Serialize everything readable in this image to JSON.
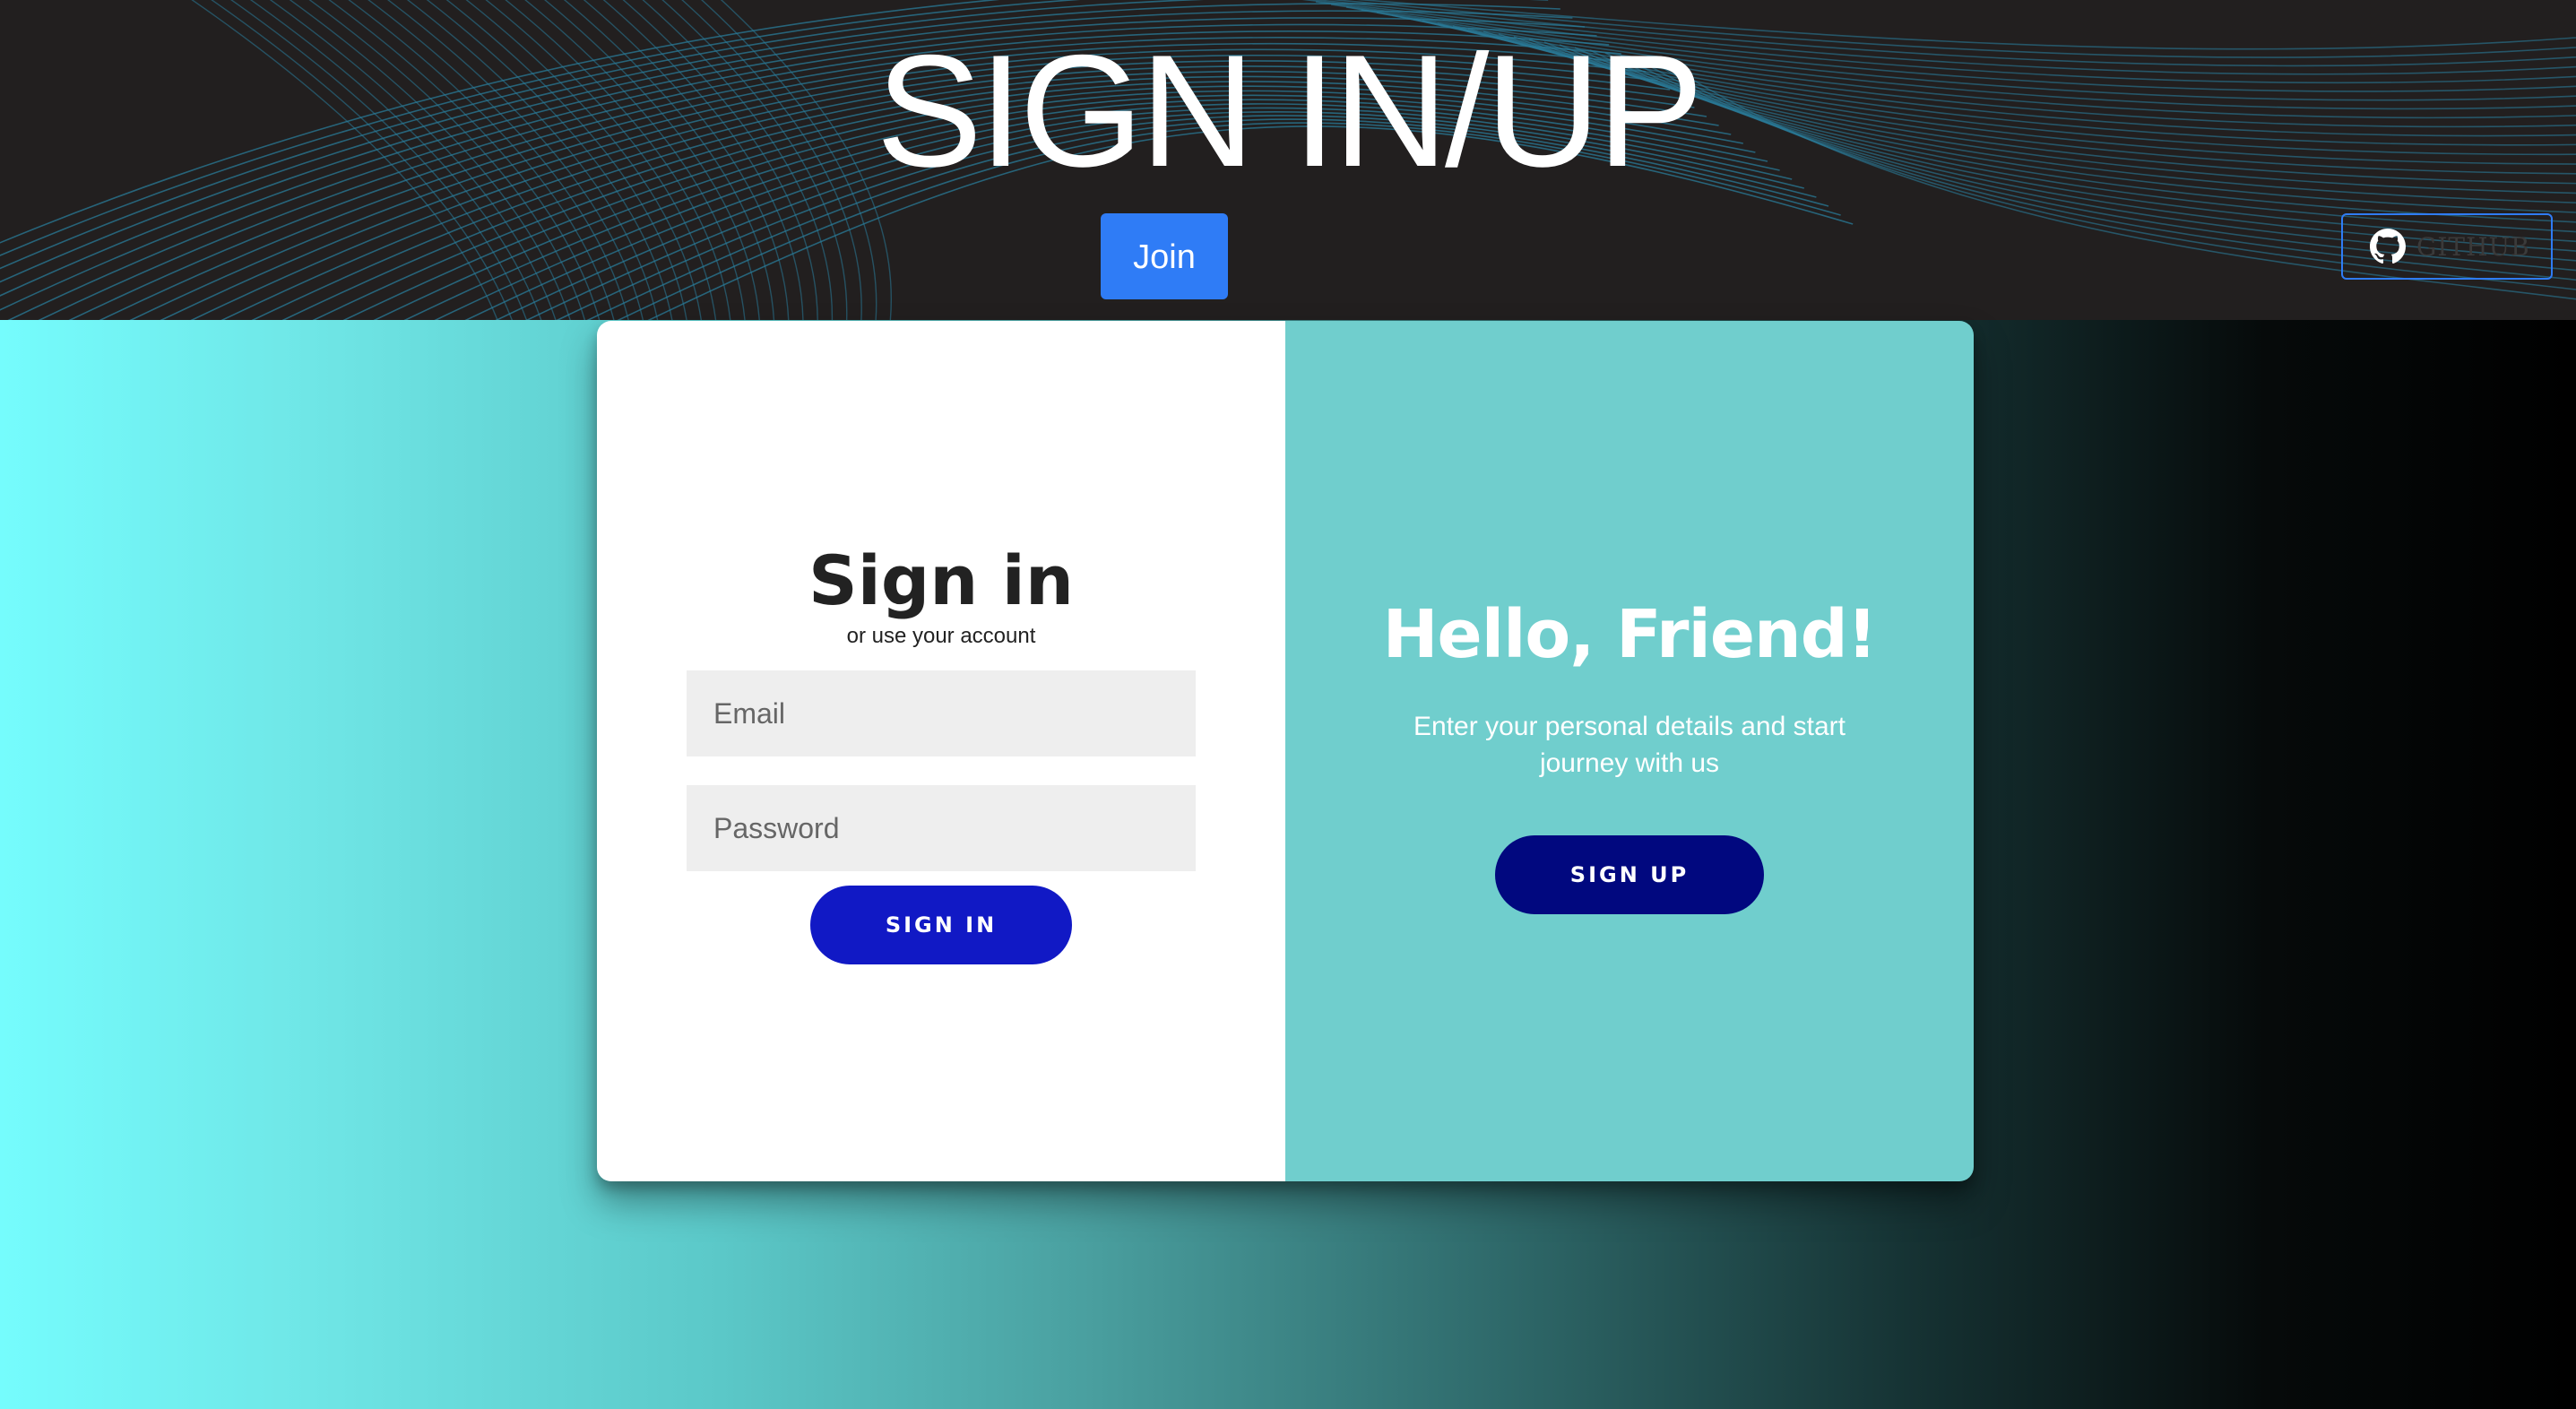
{
  "header": {
    "title": "SIGN IN/UP",
    "join_label": "Join",
    "github_label": "GITHUB",
    "github_icon": "github-icon",
    "accent_color": "#2f7cf6"
  },
  "signin": {
    "title": "Sign in",
    "subtitle": "or use your account",
    "email_placeholder": "Email",
    "password_placeholder": "Password",
    "button_label": "SIGN IN",
    "button_color": "#1119c5"
  },
  "signup": {
    "title": "Hello, Friend!",
    "text": "Enter your personal details and start journey with us",
    "button_label": "SIGN UP",
    "button_color": "#01087f",
    "panel_color": "#70cecd"
  }
}
